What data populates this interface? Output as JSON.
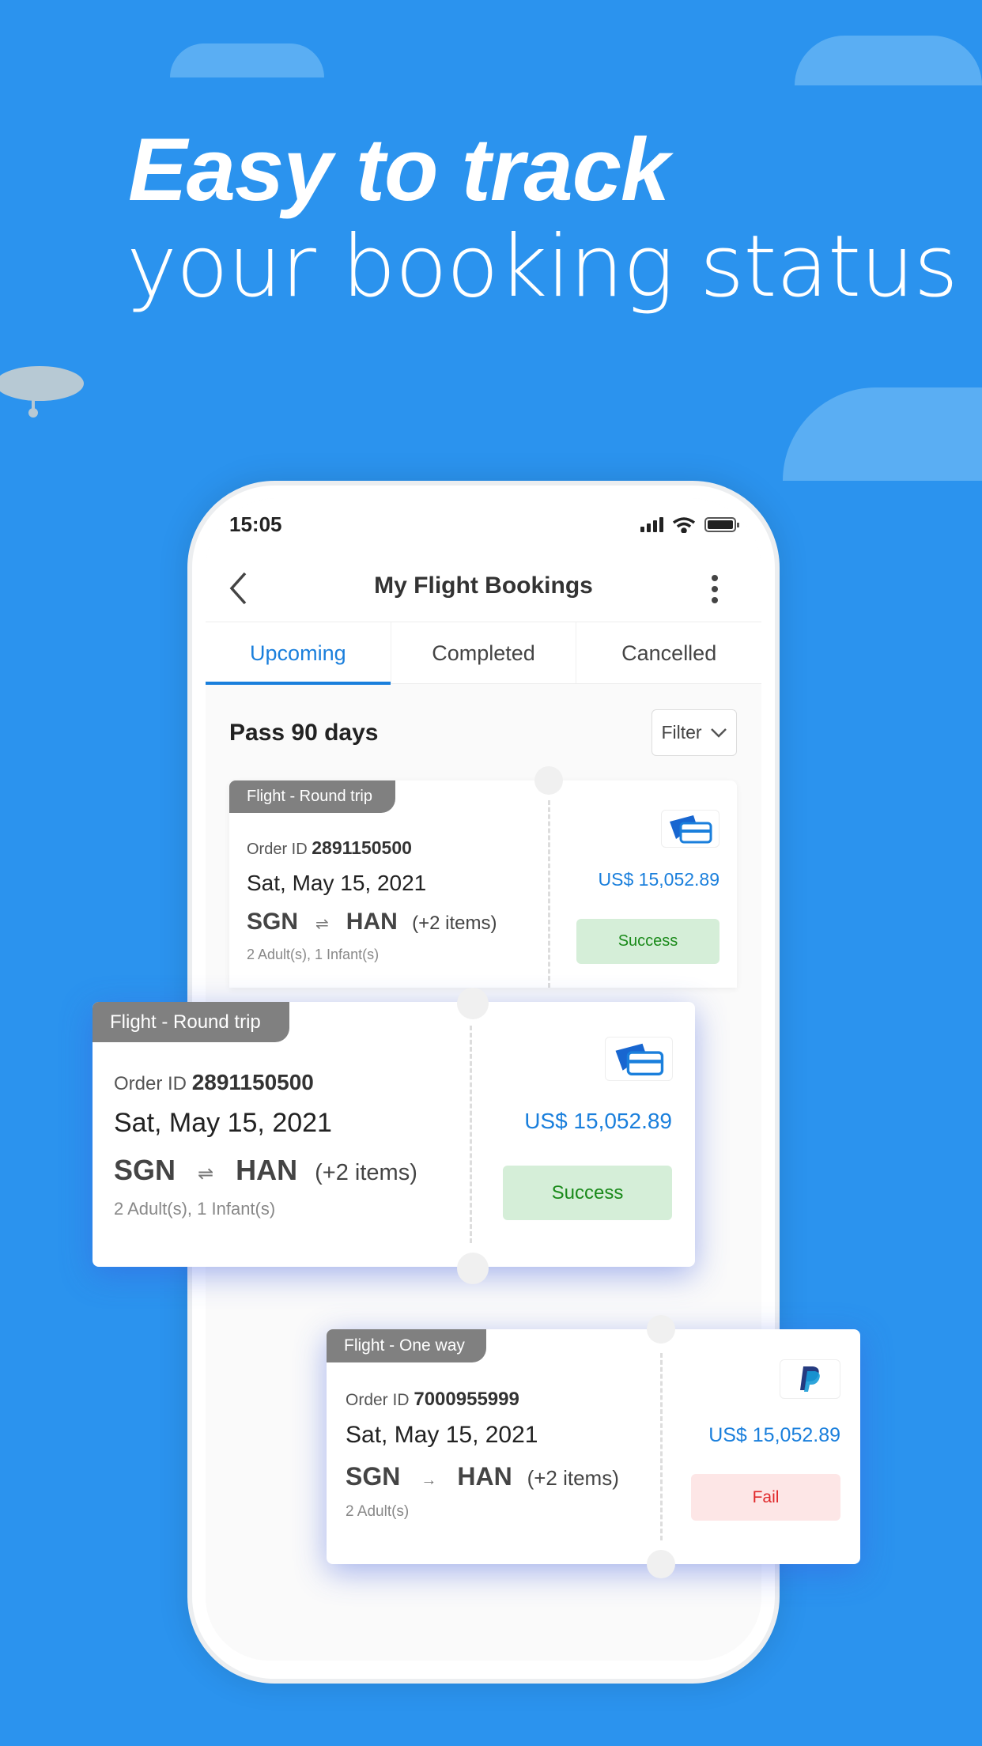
{
  "headline": {
    "line1": "Easy to track",
    "line2": "your booking status"
  },
  "status_bar": {
    "time": "15:05"
  },
  "header": {
    "title": "My Flight Bookings"
  },
  "tabs": [
    {
      "label": "Upcoming",
      "active": true
    },
    {
      "label": "Completed"
    },
    {
      "label": "Cancelled"
    }
  ],
  "section": {
    "title": "Pass 90 days",
    "filter_label": "Filter"
  },
  "colors": {
    "background": "#2b93ee",
    "accent": "#1a7fdc",
    "success_bg": "#d5eed8",
    "success_text": "#1a8a1a",
    "fail_bg": "#fde6e6",
    "fail_text": "#e0282a"
  },
  "bookings": [
    {
      "type": "Flight - Round trip",
      "order_label": "Order ID",
      "order_id": "2891150500",
      "date": "Sat, May 15, 2021",
      "from": "SGN",
      "arrow": "⇌",
      "to": "HAN",
      "extra": "(+2 items)",
      "passengers": "2 Adult(s), 1 Infant(s)",
      "price": "US$ 15,052.89",
      "status": "Success",
      "payment_icon": "credit-card-icon"
    },
    {
      "type": "Flight - Round trip",
      "order_label": "Order ID",
      "order_id": "2891150500",
      "date": "Sat, May 15, 2021",
      "from": "SGN",
      "arrow": "⇌",
      "to": "HAN",
      "extra": "(+2 items)",
      "passengers": "2 Adult(s), 1 Infant(s)",
      "price": "US$ 15,052.89",
      "status": "Success",
      "payment_icon": "credit-card-icon"
    },
    {
      "type": "Flight - One way",
      "order_label": "Order ID",
      "order_id": "7000955999",
      "date": "Sat, May 15, 2021",
      "from": "SGN",
      "arrow": "→",
      "to": "HAN",
      "extra": "(+2 items)",
      "passengers": "2 Adult(s)",
      "price": "US$ 15,052.89",
      "status": "Fail",
      "payment_icon": "paypal-icon"
    }
  ]
}
